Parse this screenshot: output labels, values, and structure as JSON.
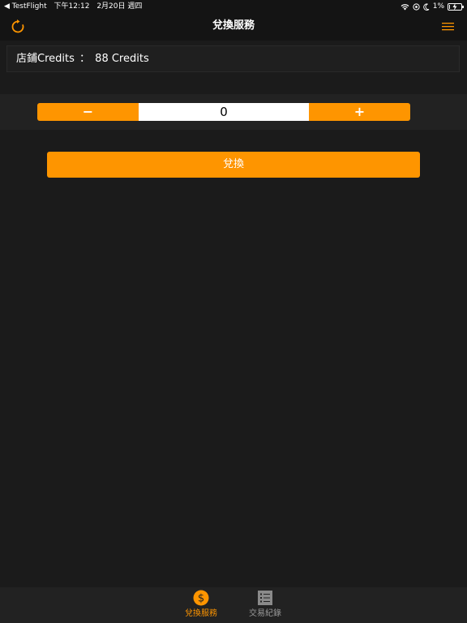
{
  "status_bar": {
    "back_app": "◀ TestFlight",
    "time": "下午12:12",
    "date": "2月20日 週四",
    "battery_percent": "1%"
  },
  "nav": {
    "title": "兌換服務",
    "refresh_icon": "refresh-icon",
    "menu_icon": "hamburger-menu-icon"
  },
  "credits": {
    "label": "店鋪Credits",
    "separator": "：",
    "value": "88 Credits"
  },
  "stepper": {
    "minus_label": "−",
    "value": "0",
    "plus_label": "+"
  },
  "exchange_button": {
    "label": "兌換"
  },
  "tabs": [
    {
      "label": "兌換服務",
      "icon": "dollar-coin-icon",
      "active": true
    },
    {
      "label": "交易紀錄",
      "icon": "list-icon",
      "active": false
    }
  ],
  "colors": {
    "accent": "#fe9500",
    "background": "#1b1b1b",
    "bar": "#141414",
    "inactive": "#9a9a9a"
  }
}
